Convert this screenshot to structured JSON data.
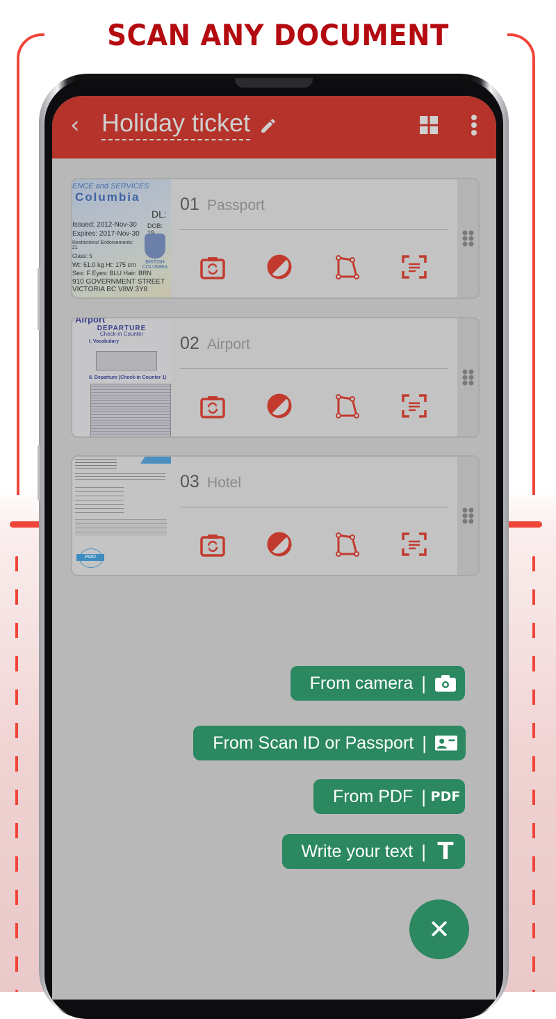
{
  "headline": "SCAN ANY DOCUMENT",
  "colors": {
    "accent_red": "#b5332a",
    "headline_red": "#b40b10",
    "action_green": "#2b8860",
    "frame_red": "#f0453a"
  },
  "appbar": {
    "back_icon": "‹",
    "title": "Holiday ticket",
    "icons": [
      "back-icon",
      "edit-pencil-icon",
      "grid-view-icon",
      "more-vert-icon"
    ]
  },
  "documents": [
    {
      "number": "01",
      "name": "Passport",
      "thumbnail": "id-card-thumbnail",
      "thumb_text": [
        "ENCE and SERVICES",
        "Columbia",
        "DL:",
        "DOB: 19",
        "Issued: 2012-Nov-30",
        "Expires: 2017-Nov-30",
        "Restrictions/ Endorsements: 21",
        "Class: 5",
        "Wt: 51.0 kg  Ht: 175 cm",
        "Sex: F  Eyes: BLU  Hair: BRN",
        "910 GOVERNMENT STREET",
        "VICTORIA BC V8W 3Y8",
        "BRITISH COLUMBIA"
      ]
    },
    {
      "number": "02",
      "name": "Airport",
      "thumbnail": "worksheet-thumbnail",
      "thumb_text": [
        "Airport",
        "DEPARTURE",
        "Check-in Counter",
        "I. Vocabulary",
        "II. Departure (Check-in Counter 1)"
      ]
    },
    {
      "number": "03",
      "name": "Hotel",
      "thumbnail": "invoice-thumbnail",
      "thumb_text": [
        "PAID"
      ]
    }
  ],
  "tools": [
    "rotate-camera-icon",
    "contrast-filter-icon",
    "crop-corners-icon",
    "scan-text-icon"
  ],
  "actions": [
    {
      "label": "From camera",
      "icon": "camera-icon"
    },
    {
      "label": "From Scan ID or Passport",
      "icon": "id-card-icon"
    },
    {
      "label": "From PDF",
      "icon": "pdf-icon",
      "icon_text": "PDF"
    },
    {
      "label": "Write your text",
      "icon": "text-icon",
      "icon_text": "T"
    }
  ],
  "fab": {
    "icon": "close-icon",
    "glyph": "✕"
  }
}
